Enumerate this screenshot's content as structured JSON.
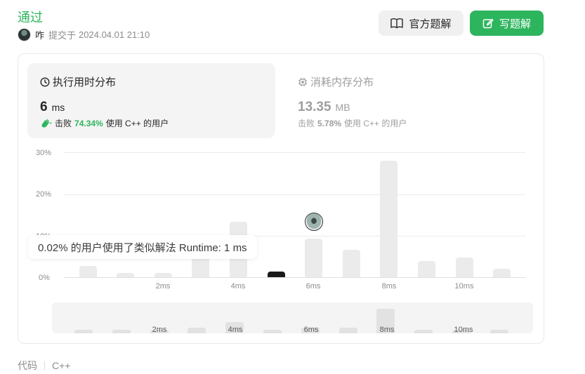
{
  "header": {
    "status": "通过",
    "user": "咋",
    "submitted_prefix": "提交于",
    "submitted_time": "2024.04.01 21:10"
  },
  "buttons": {
    "official_solution": "官方题解",
    "write_solution": "写题解"
  },
  "runtime": {
    "title": "执行用时分布",
    "value": "6",
    "unit": "ms",
    "beat_prefix": "击败",
    "beat_pct": "74.34%",
    "beat_suffix": "使用 C++ 的用户"
  },
  "memory": {
    "title": "消耗内存分布",
    "value": "13.35",
    "unit": "MB",
    "beat_prefix": "击败",
    "beat_pct": "5.78%",
    "beat_suffix": "使用 C++ 的用户"
  },
  "tooltip": "0.02% 的用户使用了类似解法 Runtime: 1 ms",
  "chart_data": {
    "type": "bar",
    "title": "",
    "xlabel": "",
    "ylabel": "",
    "ylim": [
      0,
      30
    ],
    "y_ticks": [
      "30%",
      "20%",
      "10%",
      "0%"
    ],
    "x_tick_labels": [
      "2ms",
      "4ms",
      "6ms",
      "8ms",
      "10ms"
    ],
    "x": [
      1,
      2,
      3,
      4,
      5,
      6,
      7,
      8,
      9,
      10,
      11,
      12
    ],
    "values": [
      2.7,
      1.0,
      1.0,
      6.5,
      13.3,
      1.3,
      9.2,
      6.5,
      28.0,
      3.9,
      4.7,
      2.1
    ],
    "selected_x": 6,
    "grid": true,
    "colors": {
      "bar": "#ebebeb",
      "selected": "#1a1a1a"
    }
  },
  "overview": {
    "labels": [
      "2ms",
      "4ms",
      "6ms",
      "8ms",
      "10ms"
    ],
    "values": [
      0.4,
      0.4,
      0.4,
      0.6,
      1.2,
      0.4,
      0.6,
      0.6,
      2.6,
      0.4,
      0.4,
      0.4
    ]
  },
  "footer": {
    "label": "代码",
    "language": "C++"
  },
  "colors": {
    "accent": "#2db55d"
  }
}
